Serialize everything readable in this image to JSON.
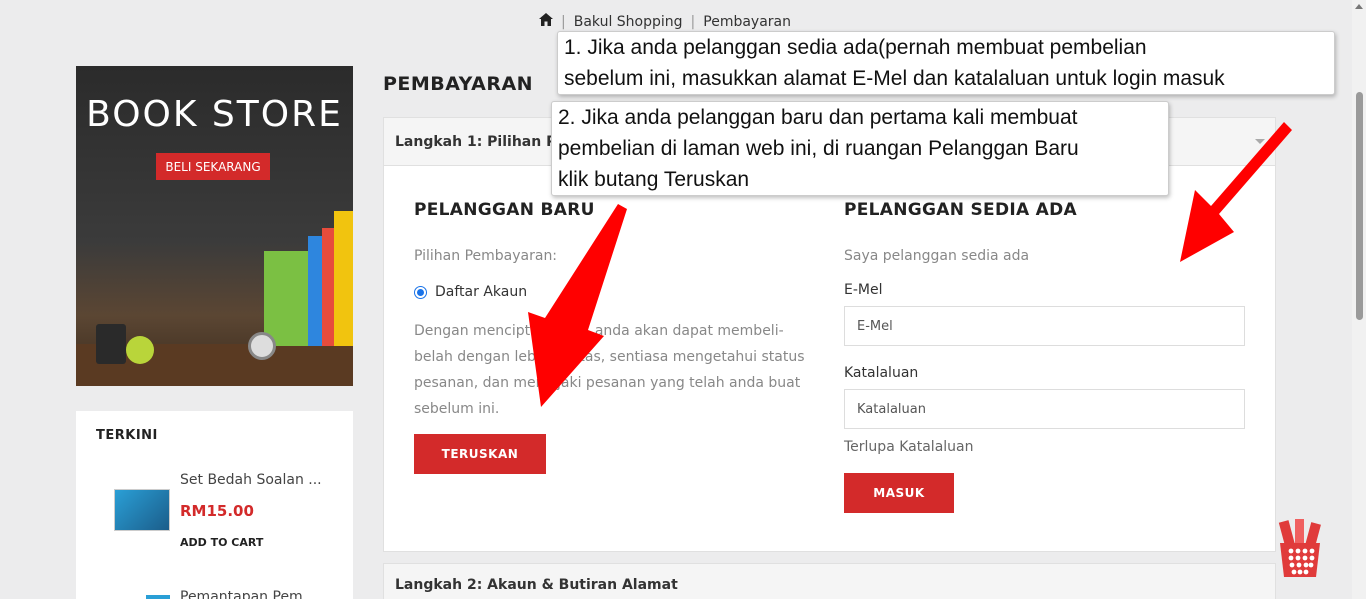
{
  "breadcrumb": {
    "home_icon": "home-icon",
    "items": [
      "Bakul Shopping",
      "Pembayaran"
    ]
  },
  "banner": {
    "title": "BOOK STORE",
    "cta": "BELI SEKARANG"
  },
  "terkini": {
    "title": "TERKINI",
    "products": [
      {
        "name": "Set Bedah Soalan ...",
        "price": "RM15.00",
        "cart": "ADD TO CART"
      },
      {
        "name": "Pemantapan Pem..."
      }
    ]
  },
  "page": {
    "heading": "PEMBAYARAN",
    "step1": "Langkah 1: Pilihan Pembayaran",
    "step2": "Langkah 2: Akaun & Butiran Alamat"
  },
  "new_customer": {
    "title": "PELANGGAN BARU",
    "payment_label": "Pilihan Pembayaran:",
    "radio_label": "Daftar Akaun",
    "description": "Dengan mencipta akaun, anda akan dapat membeli-belah dengan lebih pantas, sentiasa mengetahui status pesanan, dan menjejaki pesanan yang telah anda buat sebelum ini.",
    "button": "TERUSKAN"
  },
  "existing_customer": {
    "title": "PELANGGAN SEDIA ADA",
    "subtitle": "Saya pelanggan sedia ada",
    "email_label": "E-Mel",
    "email_placeholder": "E-Mel",
    "password_label": "Katalaluan",
    "password_placeholder": "Katalaluan",
    "forgot": "Terlupa Katalaluan",
    "button": "MASUK"
  },
  "tooltips": {
    "tip1_line1": "1. Jika anda pelanggan sedia ada(pernah membuat pembelian",
    "tip1_line2": "sebelum ini, masukkan alamat E-Mel dan katalaluan untuk login masuk",
    "tip2_line1": "2. Jika anda pelanggan baru dan pertama kali membuat",
    "tip2_line2": "pembelian di laman web ini, di ruangan Pelanggan Baru",
    "tip2_line3": "klik butang Teruskan"
  },
  "colors": {
    "accent": "#d32a2a",
    "arrow": "#ff0000",
    "background": "#ececed"
  }
}
